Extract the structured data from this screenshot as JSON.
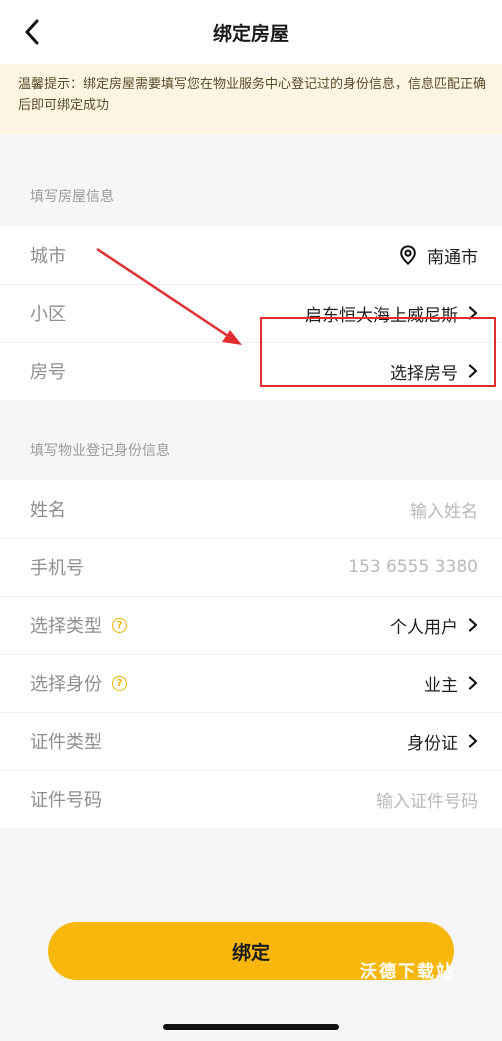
{
  "header": {
    "title": "绑定房屋"
  },
  "notice": {
    "text": "温馨提示：绑定房屋需要填写您在物业服务中心登记过的身份信息，信息匹配正确后即可绑定成功"
  },
  "house_section": {
    "title": "填写房屋信息",
    "rows": [
      {
        "label": "城市",
        "value": "南通市",
        "icon": "location-pin-icon"
      },
      {
        "label": "小区",
        "value": "启东恒大海上威尼斯"
      },
      {
        "label": "房号",
        "value": "选择房号"
      }
    ]
  },
  "identity_section": {
    "title": "填写物业登记身份信息",
    "name": {
      "label": "姓名",
      "placeholder": "输入姓名"
    },
    "phone": {
      "label": "手机号",
      "value": "153 6555 3380"
    },
    "type": {
      "label": "选择类型",
      "value": "个人用户"
    },
    "role": {
      "label": "选择身份",
      "value": "业主"
    },
    "id_type": {
      "label": "证件类型",
      "value": "身份证"
    },
    "id_number": {
      "label": "证件号码",
      "placeholder": "输入证件号码"
    }
  },
  "actions": {
    "bind_label": "绑定"
  },
  "watermark": "沃德下载站",
  "colors": {
    "accent": "#f8b70c",
    "annotation": "#e02e2e",
    "notice_bg": "#fdf5e2"
  }
}
